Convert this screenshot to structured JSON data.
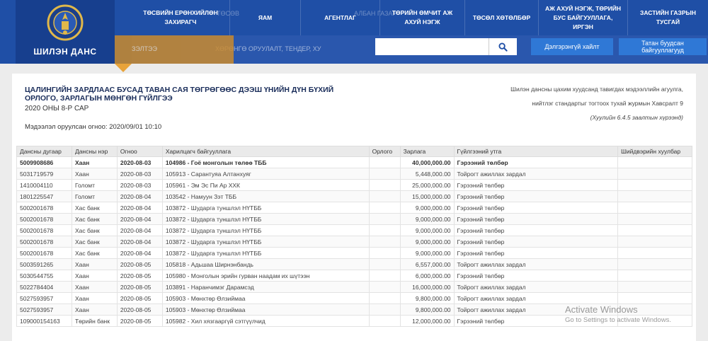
{
  "header": {
    "logo_text": "ШИЛЭН ДАНС",
    "nav": [
      {
        "label": "ТӨСВИЙН ЕРӨНХИЙЛӨН ЗАХИРАГЧ",
        "w": 138
      },
      {
        "label": "ЯАМ",
        "w": 100
      },
      {
        "label": "АГЕНТЛАГ",
        "w": 112
      },
      {
        "label": "ТӨРИЙН ӨМЧИТ АЖ АХУЙ НЭГЖ",
        "w": 120
      },
      {
        "label": "ТӨСӨЛ ХӨТӨЛБӨР",
        "w": 104
      },
      {
        "label": "АЖ АХУЙ НЭГЖ, ТӨРИЙН БУС БАЙГУУЛЛАГА, ИРГЭН",
        "w": 126
      },
      {
        "label": "ЗАСТИЙН ГАЗРЫН ТУСГАЙ",
        "w": 114
      }
    ],
    "faded_top": [
      "ТӨСӨВ",
      "АЛБАН ГАЗАР"
    ],
    "faded_sub": [
      "ЗЭЛТЭЭ",
      "ХӨРӨНГӨ ОРУУЛАЛТ, ТЕНДЕР, ХУ"
    ],
    "search_value": "",
    "search_icon": "search-icon",
    "detail_search_label": "Дэлгэрэнгүй хайлт",
    "download_label": "Татан буудсан байгууллагууд"
  },
  "content": {
    "title": "ЦАЛИНГИЙН ЗАРДЛААС БУСАД ТАВАН САЯ ТӨГРӨГӨӨС ДЭЭШ ҮНИЙН ДҮН БҮХИЙ ОРЛОГО, ЗАРЛАГЫН МӨНГӨН ГҮЙЛГЭЭ",
    "subtitle": "2020 ОНЫ 8-Р САР",
    "updated": "Мэдээлэл оруулсан огноо: 2020/09/01 10:10",
    "note_line1": "Шилэн дансны цахим хуудсанд тавигдах мэдээллийн агуулга,",
    "note_line2": "нийтлэг стандартыг тогтоох тухай журмын Хавсралт 9",
    "note_line3": "(Хуулийн 6.4.5 заалтын хүрээнд)"
  },
  "table": {
    "headers": [
      "Дансны дугаар",
      "Дансны нэр",
      "Огноо",
      "Харилцагч байгууллага",
      "Орлого",
      "Зарлага",
      "Гүйлгээний утга",
      "Шийдвэрийн хуулбар"
    ],
    "rows": [
      {
        "account": "5009908686",
        "bank": "Хаан",
        "date": "2020-08-03",
        "partner": "104986 - Гоё монголын төлөө ТББ",
        "income": "",
        "expense": "40,000,000.00",
        "purpose": "Гэрээний төлбөр",
        "doc": "",
        "bold": true
      },
      {
        "account": "5031719579",
        "bank": "Хаан",
        "date": "2020-08-03",
        "partner": "105913 - Сарантуяа Алтанхуяг",
        "income": "",
        "expense": "5,448,000.00",
        "purpose": "Тойрогт ажиллах зардал",
        "doc": ""
      },
      {
        "account": "1410004110",
        "bank": "Голомт",
        "date": "2020-08-03",
        "partner": "105961 - Эм Эс Пи Ар ХХК",
        "income": "",
        "expense": "25,000,000.00",
        "purpose": "Гэрээний төлбөр",
        "doc": ""
      },
      {
        "account": "1801225547",
        "bank": "Голомт",
        "date": "2020-08-04",
        "partner": "103542 - Намуун Зэт ТББ",
        "income": "",
        "expense": "15,000,000.00",
        "purpose": "Гэрээний төлбөр",
        "doc": ""
      },
      {
        "account": "5002001678",
        "bank": "Хас банк",
        "date": "2020-08-04",
        "partner": "103872 - Шударга туншлэл НҮТББ",
        "income": "",
        "expense": "9,000,000.00",
        "purpose": "Гэрээний төлбөр",
        "doc": ""
      },
      {
        "account": "5002001678",
        "bank": "Хас банк",
        "date": "2020-08-04",
        "partner": "103872 - Шударга туншлэл НҮТББ",
        "income": "",
        "expense": "9,000,000.00",
        "purpose": "Гэрээний төлбөр",
        "doc": ""
      },
      {
        "account": "5002001678",
        "bank": "Хас банк",
        "date": "2020-08-04",
        "partner": "103872 - Шударга туншлэл НҮТББ",
        "income": "",
        "expense": "9,000,000.00",
        "purpose": "Гэрээний төлбөр",
        "doc": ""
      },
      {
        "account": "5002001678",
        "bank": "Хас банк",
        "date": "2020-08-04",
        "partner": "103872 - Шударга туншлэл НҮТББ",
        "income": "",
        "expense": "9,000,000.00",
        "purpose": "Гэрээний төлбөр",
        "doc": ""
      },
      {
        "account": "5002001678",
        "bank": "Хас банк",
        "date": "2020-08-04",
        "partner": "103872 - Шударга туншлэл НҮТББ",
        "income": "",
        "expense": "9,000,000.00",
        "purpose": "Гэрээний төлбөр",
        "doc": ""
      },
      {
        "account": "5003591265",
        "bank": "Хаан",
        "date": "2020-08-05",
        "partner": "105818 - Адьшаа Ширнэнбандь",
        "income": "",
        "expense": "6,557,000.00",
        "purpose": "Тойрогт ажиллах зардал",
        "doc": ""
      },
      {
        "account": "5030544755",
        "bank": "Хаан",
        "date": "2020-08-05",
        "partner": "105980 - Монголын эрийн гурван наадам их шүтээн",
        "income": "",
        "expense": "6,000,000.00",
        "purpose": "Гэрээний төлбөр",
        "doc": ""
      },
      {
        "account": "5022784404",
        "bank": "Хаан",
        "date": "2020-08-05",
        "partner": "103891 - Наранчимэг Дарамсэд",
        "income": "",
        "expense": "16,000,000.00",
        "purpose": "Тойрогт ажиллах зардал",
        "doc": ""
      },
      {
        "account": "5027593957",
        "bank": "Хаан",
        "date": "2020-08-05",
        "partner": "105903 - Мөнхтөр Өлзиймаа",
        "income": "",
        "expense": "9,800,000.00",
        "purpose": "Тойрогт ажиллах зардал",
        "doc": ""
      },
      {
        "account": "5027593957",
        "bank": "Хаан",
        "date": "2020-08-05",
        "partner": "105903 - Мөнхтөр Өлзиймаа",
        "income": "",
        "expense": "9,800,000.00",
        "purpose": "Тойрогт ажиллах зардал",
        "doc": ""
      },
      {
        "account": "109000154163",
        "bank": "Төрийн банк",
        "date": "2020-08-05",
        "partner": "105982 - Хил хязгааргүй сэтгүүлчид",
        "income": "",
        "expense": "12,000,000.00",
        "purpose": "Гэрээний төлбөр",
        "doc": ""
      }
    ]
  },
  "watermark": {
    "line1": "Activate Windows",
    "line2": "Go to Settings to activate Windows."
  }
}
